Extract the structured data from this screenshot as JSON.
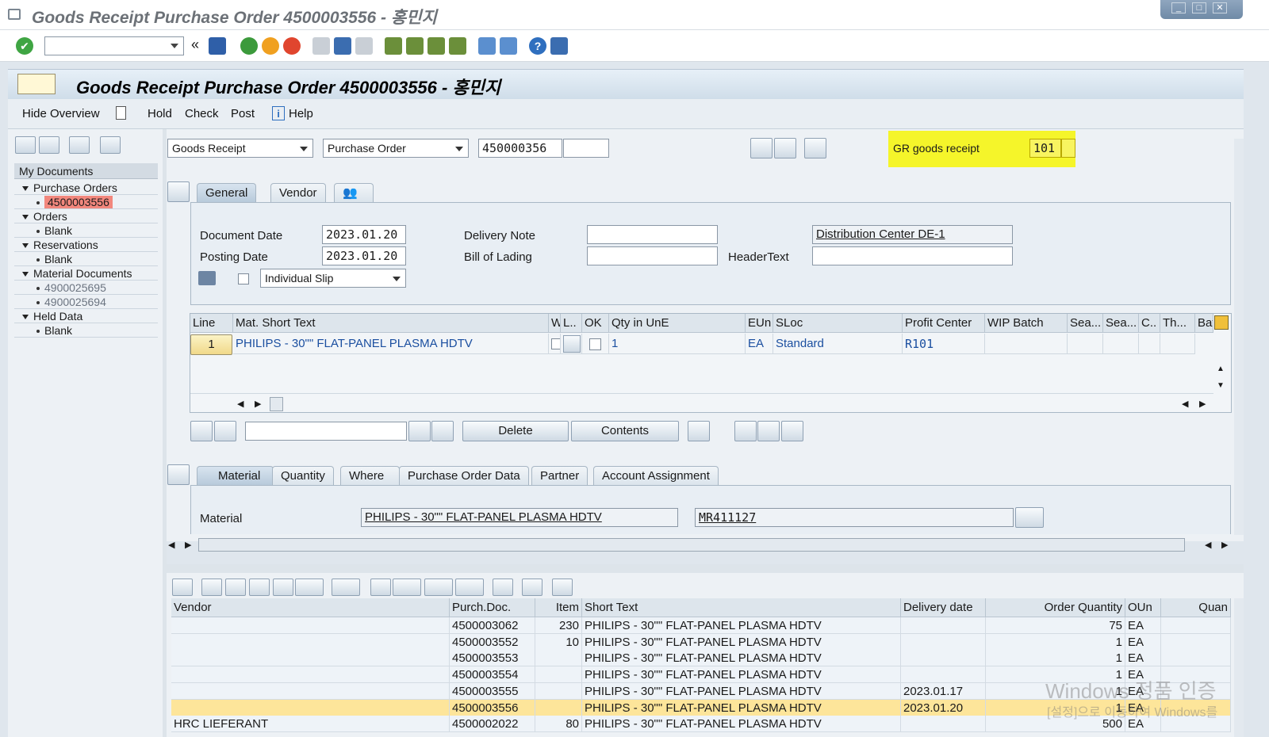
{
  "window": {
    "title": "Goods Receipt Purchase Order 4500003556 - 홍민지"
  },
  "header": {
    "title": "Goods Receipt Purchase Order 4500003556 - 홍민지"
  },
  "appbar": {
    "hide_overview": "Hide Overview",
    "hold": "Hold",
    "check": "Check",
    "post": "Post",
    "help": "Help"
  },
  "tree": {
    "root": "My Documents",
    "purchase_orders": "Purchase Orders",
    "po_item": "4500003556",
    "orders": "Orders",
    "orders_item": "Blank",
    "reservations": "Reservations",
    "reservations_item": "Blank",
    "material_documents": "Material Documents",
    "md_item1": "4900025695",
    "md_item2": "4900025694",
    "held_data": "Held Data",
    "held_item": "Blank"
  },
  "selection": {
    "action": "Goods Receipt",
    "ref_doc": "Purchase Order",
    "po_number": "450000356",
    "mvt_label": "GR goods receipt",
    "mvt_value": "101"
  },
  "tabs_header": {
    "general": "General",
    "vendor": "Vendor"
  },
  "general": {
    "doc_date_label": "Document Date",
    "doc_date": "2023.01.20",
    "post_date_label": "Posting Date",
    "post_date": "2023.01.20",
    "delivery_note_label": "Delivery Note",
    "bol_label": "Bill of Lading",
    "header_text_label": "HeaderText",
    "plant_text": "Distribution Center DE-1",
    "slip": "Individual Slip"
  },
  "items_grid": {
    "headers": [
      "Line",
      "Mat. Short Text",
      "W",
      "L..",
      "OK",
      "Qty in UnE",
      "EUn",
      "SLoc",
      "Profit Center",
      "WIP Batch",
      "Sea...",
      "Sea...",
      "C..",
      "Th...",
      "Bat"
    ],
    "row": {
      "line": "1",
      "text": "PHILIPS - 30\"\" FLAT-PANEL PLASMA HDTV",
      "qty": "1",
      "eun": "EA",
      "sloc": "Standard",
      "pc": "R101"
    }
  },
  "grid_buttons": {
    "delete": "Delete",
    "contents": "Contents"
  },
  "tabs_item": {
    "material": "Material",
    "quantity": "Quantity",
    "where": "Where",
    "po_data": "Purchase Order Data",
    "partner": "Partner",
    "account": "Account Assignment"
  },
  "material": {
    "label": "Material",
    "text": "PHILIPS - 30\"\" FLAT-PANEL PLASMA HDTV",
    "number": "MR411127"
  },
  "alv": {
    "headers": {
      "vendor": "Vendor",
      "purch_doc": "Purch.Doc.",
      "item": "Item",
      "short_text": "Short Text",
      "delivery_date": "Delivery date",
      "order_qty": "Order Quantity",
      "oun": "OUn",
      "quan": "Quan"
    },
    "rows": [
      {
        "vendor": "",
        "doc": "4500003062",
        "item": "230",
        "text": "PHILIPS - 30\"\" FLAT-PANEL PLASMA HDTV",
        "date": "",
        "qty": "75",
        "oun": "EA"
      },
      {
        "vendor": "",
        "doc": "4500003552",
        "item": "10",
        "text": "PHILIPS - 30\"\" FLAT-PANEL PLASMA HDTV",
        "date": "",
        "qty": "1",
        "oun": "EA"
      },
      {
        "vendor": "",
        "doc": "4500003553",
        "item": "",
        "text": "PHILIPS - 30\"\" FLAT-PANEL PLASMA HDTV",
        "date": "",
        "qty": "1",
        "oun": "EA"
      },
      {
        "vendor": "",
        "doc": "4500003554",
        "item": "",
        "text": "PHILIPS - 30\"\" FLAT-PANEL PLASMA HDTV",
        "date": "",
        "qty": "1",
        "oun": "EA"
      },
      {
        "vendor": "",
        "doc": "4500003555",
        "item": "",
        "text": "PHILIPS - 30\"\" FLAT-PANEL PLASMA HDTV",
        "date": "2023.01.17",
        "qty": "1",
        "oun": "EA"
      },
      {
        "vendor": "",
        "doc": "4500003556",
        "item": "",
        "text": "PHILIPS - 30\"\" FLAT-PANEL PLASMA HDTV",
        "date": "2023.01.20",
        "qty": "1",
        "oun": "EA"
      },
      {
        "vendor": "HRC LIEFERANT",
        "doc": "4500002022",
        "item": "80",
        "text": "PHILIPS - 30\"\" FLAT-PANEL PLASMA HDTV",
        "date": "",
        "qty": "500",
        "oun": "EA"
      }
    ]
  },
  "watermark": {
    "line1": "Windows 정품 인증",
    "line2": "[설정]으로 이동하여 Windows를"
  },
  "colors": {
    "highlight": "#f5f52a",
    "selected_row": "#fde59a",
    "tree_selected": "#f2877d"
  }
}
